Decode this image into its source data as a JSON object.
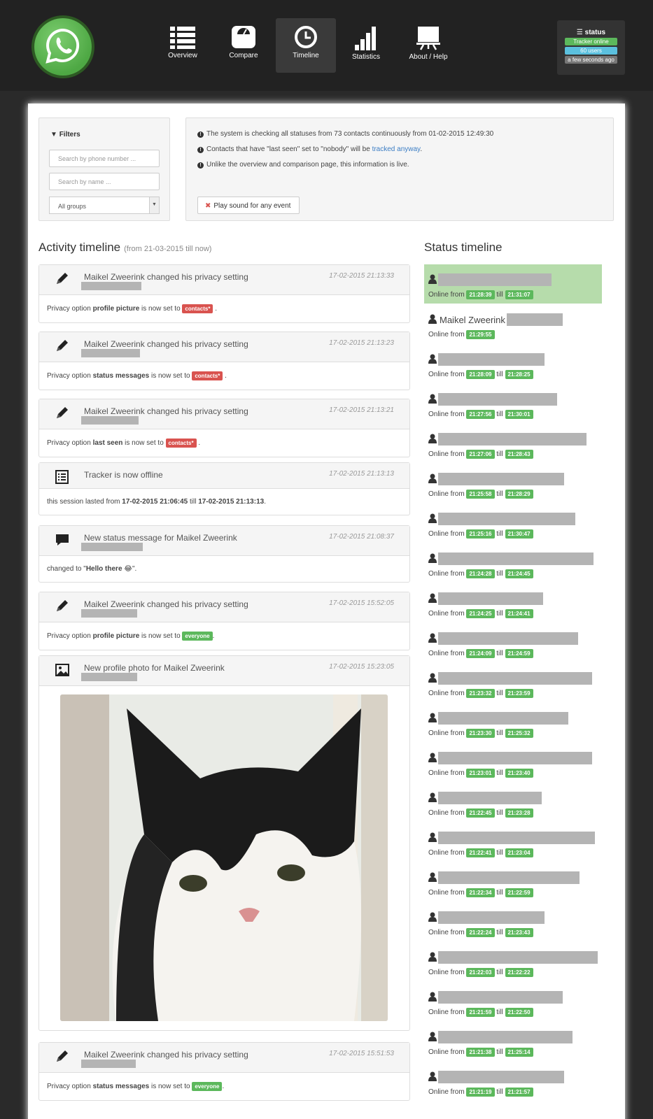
{
  "nav": [
    {
      "label": "Overview",
      "icon": "list-icon"
    },
    {
      "label": "Compare",
      "icon": "scale-icon"
    },
    {
      "label": "Timeline",
      "icon": "clock-icon"
    },
    {
      "label": "Statistics",
      "icon": "bar-chart-icon"
    },
    {
      "label": "About / Help",
      "icon": "presentation-icon"
    }
  ],
  "status": {
    "title": "status",
    "tracker": "Tracker online",
    "users": "60 users",
    "updated": "a few seconds ago"
  },
  "filters": {
    "title": "Filters",
    "phone_placeholder": "Search by phone number ...",
    "name_placeholder": "Search by name ...",
    "group": "All groups"
  },
  "info": {
    "line1": "The system is checking all statuses from 73 contacts continuously from 01-02-2015 12:49:30",
    "line2_pre": "Contacts that have \"last seen\" set to \"nobody\" will be ",
    "line2_link": "tracked anyway",
    "line2_post": ".",
    "line3": "Unlike the overview and comparison page, this information is live.",
    "sound_button": "Play sound for any event"
  },
  "activity": {
    "title": "Activity timeline",
    "range": "(from 21-03-2015 till now)",
    "events": [
      {
        "icon": "pencil-icon",
        "title": "Maikel Zweerink changed his privacy setting",
        "time": "17-02-2015 21:13:33",
        "pre": "Privacy option ",
        "bold": "profile picture",
        "mid": " is now set to ",
        "badge": "contacts*",
        "badge_color": "#d9534f",
        "post": " ."
      },
      {
        "icon": "pencil-icon",
        "title": "Maikel Zweerink changed his privacy setting",
        "time": "17-02-2015 21:13:23",
        "pre": "Privacy option ",
        "bold": "status messages",
        "mid": " is now set to ",
        "badge": "contacts*",
        "badge_color": "#d9534f",
        "post": " ."
      },
      {
        "icon": "pencil-icon",
        "title": "Maikel Zweerink changed his privacy setting",
        "time": "17-02-2015 21:13:21",
        "pre": "Privacy option ",
        "bold": "last seen",
        "mid": " is now set to ",
        "badge": "contacts*",
        "badge_color": "#d9534f",
        "post": " ."
      },
      {
        "icon": "list-alt-icon",
        "title": "Tracker is now offline",
        "time": "17-02-2015 21:13:13",
        "pre": "this session lasted from ",
        "bold": "17-02-2015 21:06:45",
        "mid": " till ",
        "bold2": "17-02-2015 21:13:13",
        "post": "."
      },
      {
        "icon": "comment-icon",
        "title": "New status message for Maikel Zweerink",
        "time": "17-02-2015 21:08:37",
        "pre": "changed to \"",
        "bold": "Hello there 😂",
        "post": "\"."
      },
      {
        "icon": "pencil-icon",
        "title": "Maikel Zweerink changed his privacy setting",
        "time": "17-02-2015 15:52:05",
        "pre": "Privacy option ",
        "bold": "profile picture",
        "mid": " is now set to ",
        "badge": "everyone",
        "badge_color": "#5cb85c",
        "post": "."
      },
      {
        "icon": "picture-icon",
        "title": "New profile photo for Maikel Zweerink",
        "time": "17-02-2015 15:23:05"
      },
      {
        "icon": "pencil-icon",
        "title": "Maikel Zweerink changed his privacy setting",
        "time": "17-02-2015 15:51:53",
        "pre": "Privacy option ",
        "bold": "status messages",
        "mid": " is now set to ",
        "badge": "everyone",
        "badge_color": "#5cb85c",
        "post": "."
      }
    ]
  },
  "status_timeline": {
    "title": "Status timeline",
    "online_from": "Online from",
    "till": "till",
    "items": [
      {
        "name": "",
        "from": "21:28:39",
        "to": "21:31:07"
      },
      {
        "name": "Maikel Zweerink",
        "from": "21:29:55",
        "to": ""
      },
      {
        "name": "",
        "from": "21:28:09",
        "to": "21:28:25"
      },
      {
        "name": "",
        "from": "21:27:56",
        "to": "21:30:01"
      },
      {
        "name": "",
        "from": "21:27:06",
        "to": "21:28:43"
      },
      {
        "name": "",
        "from": "21:25:58",
        "to": "21:28:29"
      },
      {
        "name": "",
        "from": "21:25:16",
        "to": "21:30:47"
      },
      {
        "name": "",
        "from": "21:24:28",
        "to": "21:24:45"
      },
      {
        "name": "",
        "from": "21:24:25",
        "to": "21:24:41"
      },
      {
        "name": "",
        "from": "21:24:09",
        "to": "21:24:59"
      },
      {
        "name": "",
        "from": "21:23:32",
        "to": "21:23:59"
      },
      {
        "name": "",
        "from": "21:23:30",
        "to": "21:25:32"
      },
      {
        "name": "",
        "from": "21:23:01",
        "to": "21:23:40"
      },
      {
        "name": "",
        "from": "21:22:45",
        "to": "21:23:28"
      },
      {
        "name": "",
        "from": "21:22:41",
        "to": "21:23:04"
      },
      {
        "name": "",
        "from": "21:22:34",
        "to": "21:22:59"
      },
      {
        "name": "",
        "from": "21:22:24",
        "to": "21:23:43"
      },
      {
        "name": "",
        "from": "21:22:03",
        "to": "21:22:22"
      },
      {
        "name": "",
        "from": "21:21:59",
        "to": "21:22:50"
      },
      {
        "name": "",
        "from": "21:21:38",
        "to": "21:25:14"
      },
      {
        "name": "",
        "from": "21:21:19",
        "to": "21:21:57"
      }
    ]
  }
}
